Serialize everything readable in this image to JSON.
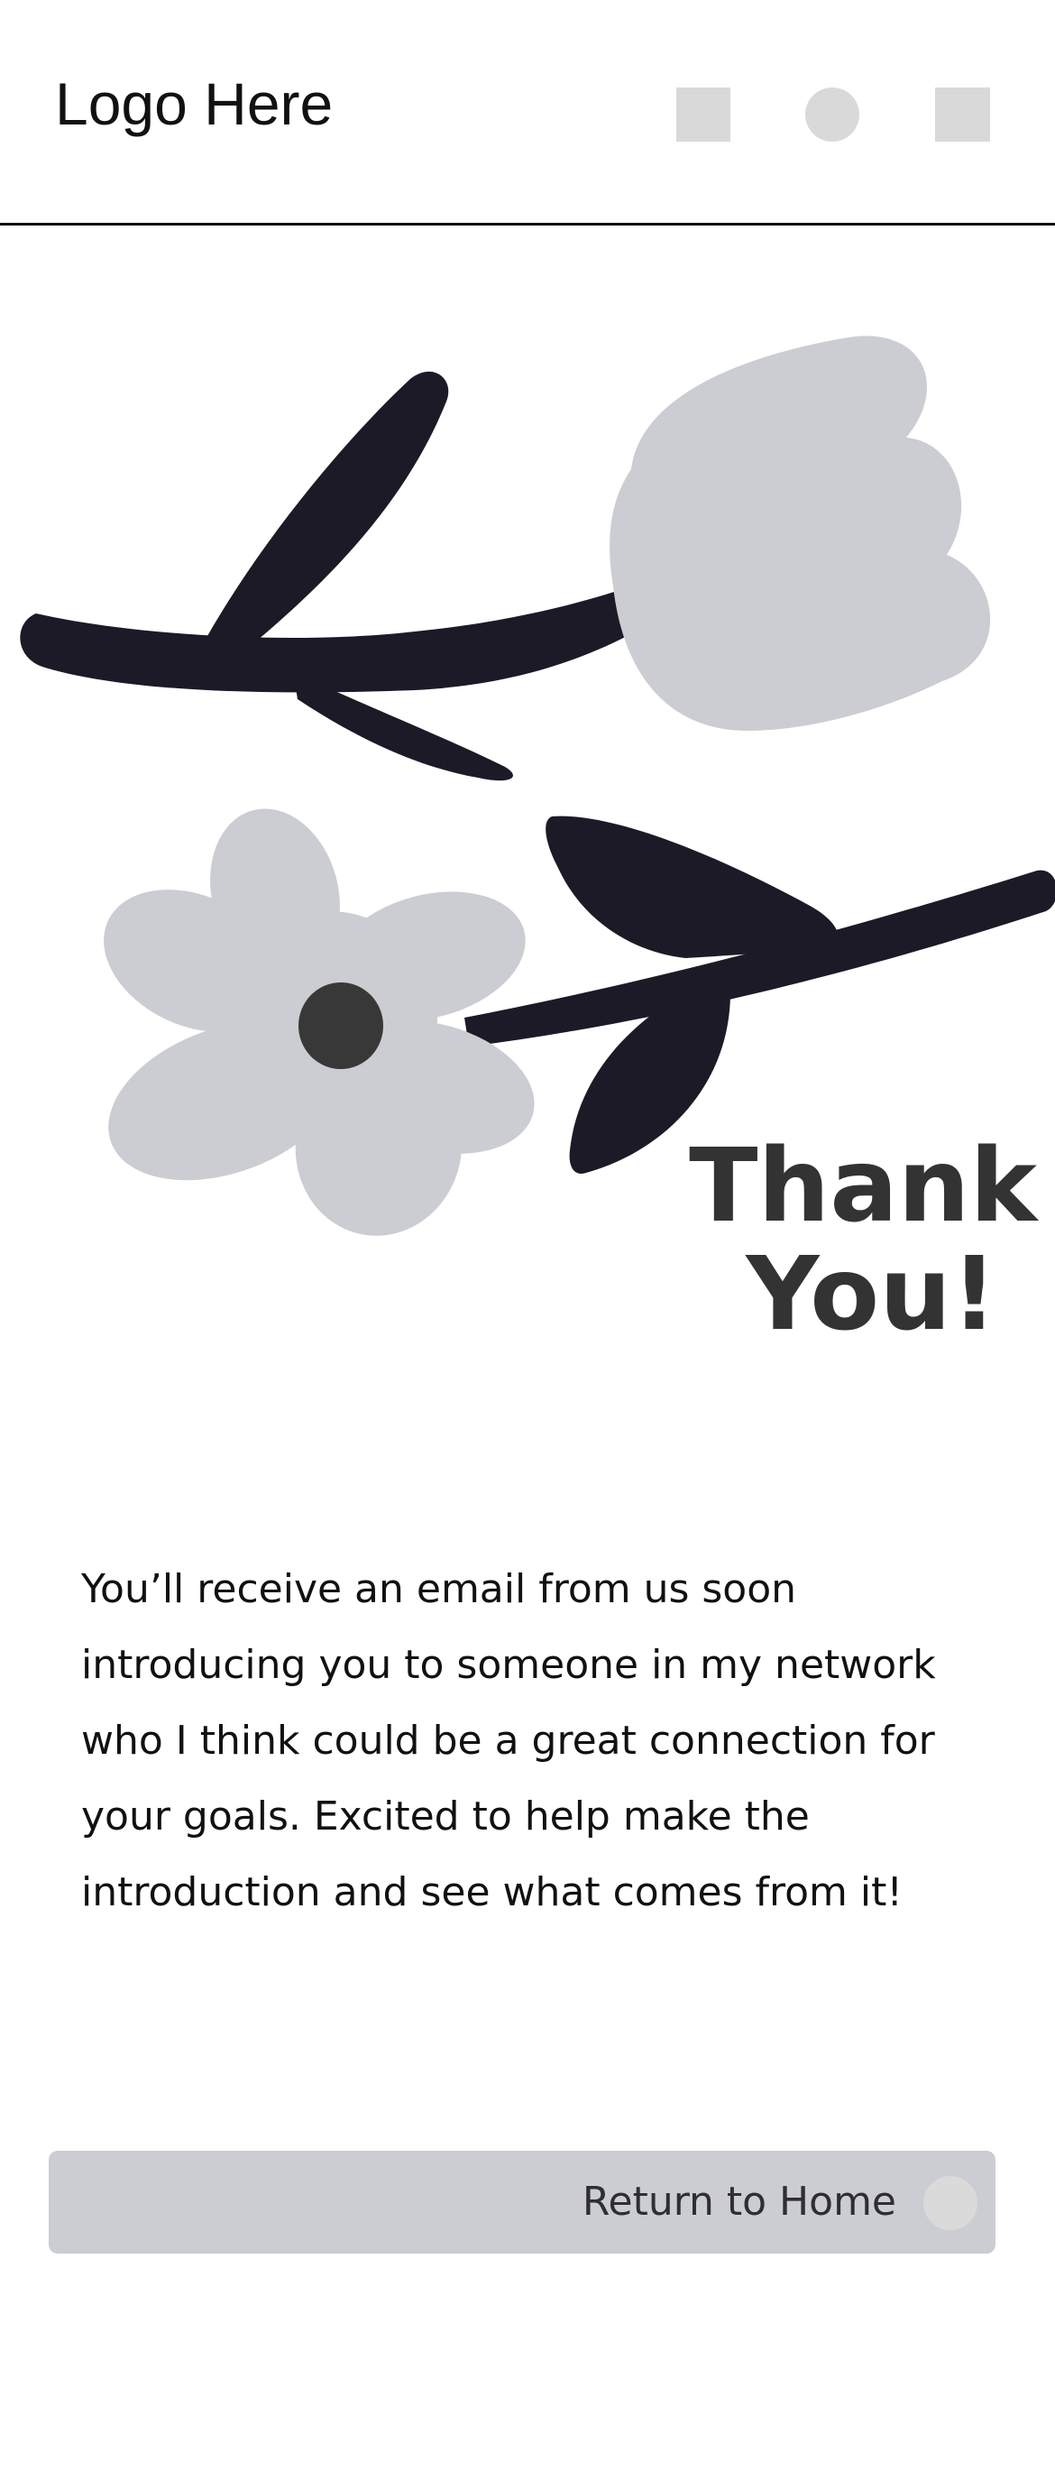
{
  "header": {
    "logo": "Logo Here",
    "icons": [
      "square-icon",
      "circle-icon",
      "square-icon"
    ]
  },
  "hero": {
    "line1": "Thank",
    "line2": "You!"
  },
  "message": {
    "text": "You’ll receive an email from us soon introducing you to someone in my network who I think could be a great connection for your goals. Excited to help make the introduction and see what comes from it!"
  },
  "cta": {
    "label": "Return to Home",
    "icon": "circle-icon"
  },
  "colors": {
    "dark": "#1b1a26",
    "light_gray": "#cbcdd3",
    "flower_center": "#383838",
    "icon_gray": "#d9d9d9",
    "heading": "#333333"
  }
}
